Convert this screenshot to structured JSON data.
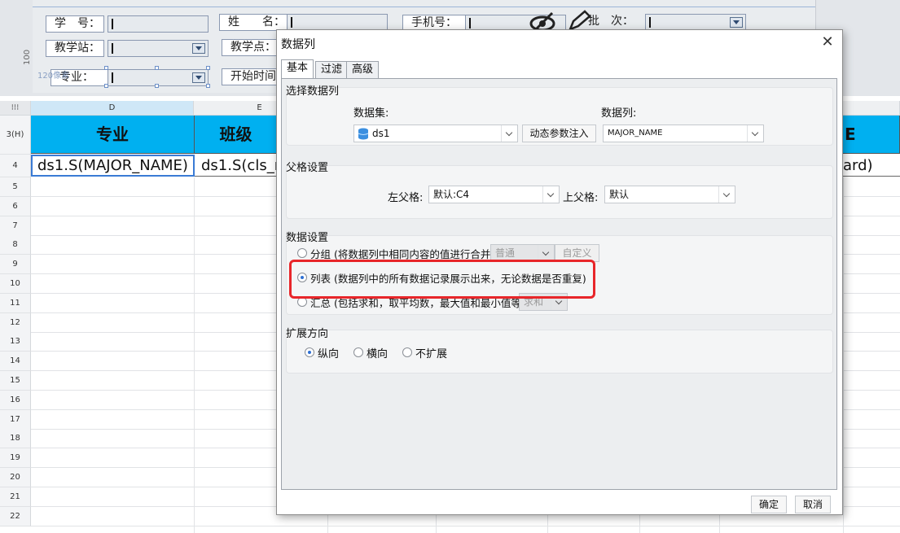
{
  "param_panel": {
    "fields": [
      {
        "label": "学　号：",
        "has_dropdown": false
      },
      {
        "label": "姓　　名：",
        "has_dropdown": false
      },
      {
        "label": "手机号：",
        "has_dropdown": false
      },
      {
        "label": "批　次：",
        "has_dropdown": true
      },
      {
        "label": "教学站：",
        "has_dropdown": true
      },
      {
        "label": "教学点：",
        "has_dropdown": false
      },
      {
        "label": "专业：",
        "has_dropdown": true
      },
      {
        "label": "开始时间",
        "has_dropdown": false
      }
    ],
    "ruler_value": "100",
    "ruler_mark": "120像素"
  },
  "sheet": {
    "columns": [
      "D",
      "E"
    ],
    "header_row_label": "3(H)",
    "header_cells": [
      "专业",
      "班级",
      "E"
    ],
    "data_row_label": "4",
    "data_cells": [
      "ds1.S(MAJOR_NAME)",
      "ds1.S(cls_n",
      "ard)"
    ],
    "row_numbers": [
      "5",
      "6",
      "7",
      "8",
      "9",
      "10",
      "11",
      "12",
      "13",
      "14",
      "15",
      "16",
      "17",
      "18",
      "19",
      "20",
      "21",
      "22"
    ]
  },
  "dialog": {
    "title": "数据列",
    "tabs": [
      "基本",
      "过滤",
      "高级"
    ],
    "active_tab": "基本",
    "select_data_column": {
      "title": "选择数据列",
      "dataset_label": "数据集:",
      "dataset_value": "ds1",
      "dynamic_param_button": "动态参数注入",
      "column_label": "数据列:",
      "column_value": "MAJOR_NAME"
    },
    "parent_settings": {
      "title": "父格设置",
      "left_parent_label": "左父格:",
      "left_parent_value": "默认:C4",
      "top_parent_label": "上父格:",
      "top_parent_value": "默认"
    },
    "data_settings": {
      "title": "数据设置",
      "options": [
        {
          "label": "分组 (将数据列中相同内容的值进行合并)",
          "selected": false,
          "combo": "普通",
          "button": "自定义"
        },
        {
          "label": "列表 (数据列中的所有数据记录展示出来，无论数据是否重复)",
          "selected": true
        },
        {
          "label": "汇总 (包括求和，取平均数，最大值和最小值等)",
          "selected": false,
          "combo": "求和"
        }
      ]
    },
    "expand_direction": {
      "title": "扩展方向",
      "options": [
        {
          "label": "纵向",
          "selected": true
        },
        {
          "label": "横向",
          "selected": false
        },
        {
          "label": "不扩展",
          "selected": false
        }
      ]
    },
    "ok_button": "确定",
    "cancel_button": "取消"
  },
  "colors": {
    "header_fill": "#00b0f0",
    "highlight": "#e8262a",
    "radio_selected": "#2d6fd3"
  }
}
